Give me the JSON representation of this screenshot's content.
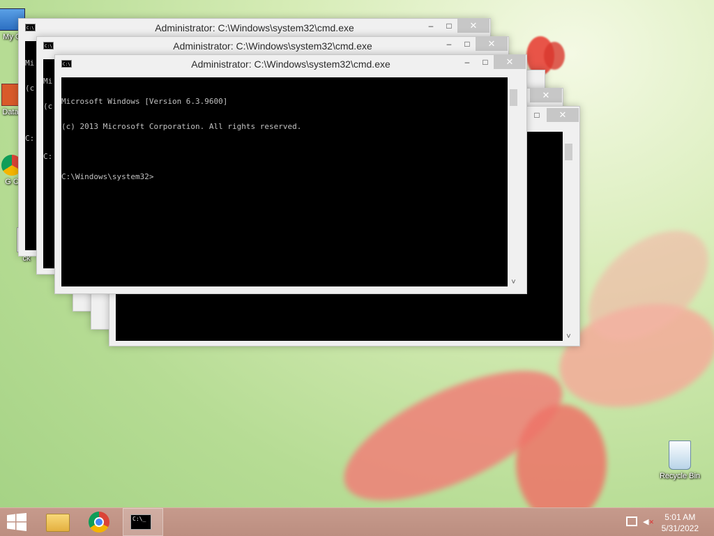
{
  "desktop": {
    "icons": [
      {
        "label": "My C",
        "icon": "computer-icon"
      },
      {
        "label": "Data",
        "icon": "shortcut-icon"
      },
      {
        "label": "G C",
        "icon": "chrome-shortcut-icon"
      },
      {
        "label": "ck",
        "icon": "file-icon"
      }
    ],
    "recycle_bin": {
      "label": "Recycle Bin",
      "icon": "recycle-bin-icon"
    }
  },
  "windows": [
    {
      "title": "Administrator: C:\\Windows\\system32\\cmd.exe",
      "lines": [
        "Mi",
        "(c",
        "",
        "C:"
      ]
    },
    {
      "title": "Administrator: C:\\Windows\\system32\\cmd.exe",
      "lines": [
        "Mi",
        "(c",
        "",
        "C:"
      ]
    },
    {
      "title": "Administrator: C:\\Windows\\system32\\cmd.exe",
      "lines": [
        "Microsoft Windows [Version 6.3.9600]",
        "(c) 2013 Microsoft Corporation. All rights reserved.",
        "",
        "C:\\Windows\\system32>"
      ]
    }
  ],
  "window_buttons": {
    "minimize": "–",
    "maximize": "□",
    "close": "✕"
  },
  "scroll": {
    "up": "˄",
    "down": "˅"
  },
  "taskbar": {
    "start_icon": "windows-start-icon",
    "apps": [
      "file-explorer-icon",
      "chrome-icon",
      "cmd-icon"
    ],
    "cmd_label": "C:\\_",
    "time": "5:01 AM",
    "date": "5/31/2022"
  },
  "colors": {
    "taskbar": "#c69a8c",
    "console_bg": "#000000",
    "console_text": "#c0c0c0",
    "close_button": "#c7c7c7"
  }
}
